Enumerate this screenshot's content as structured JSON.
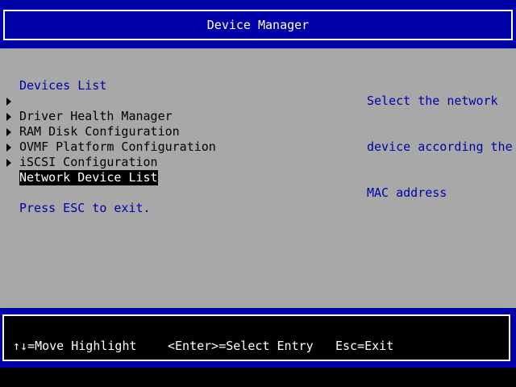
{
  "header": {
    "title": "Device Manager"
  },
  "main": {
    "section_title": "Devices List",
    "items": [
      {
        "label": "Driver Health Manager"
      },
      {
        "label": "RAM Disk Configuration"
      },
      {
        "label": "OVMF Platform Configuration"
      },
      {
        "label": "iSCSI Configuration"
      },
      {
        "label": "Network Device List"
      }
    ],
    "selected_index": 4,
    "exit_hint": "Press ESC to exit."
  },
  "help": {
    "lines": [
      "Select the network",
      "device according the",
      "MAC address"
    ]
  },
  "footer": {
    "move": "↑↓=Move Highlight",
    "select": "<Enter>=Select Entry",
    "exit": "Esc=Exit"
  },
  "colors": {
    "header_bg": "#0000a8",
    "body_bg": "#a8a8a8",
    "accent_text": "#0000a8",
    "selected_bg": "#000000",
    "selected_fg": "#ffffff"
  }
}
